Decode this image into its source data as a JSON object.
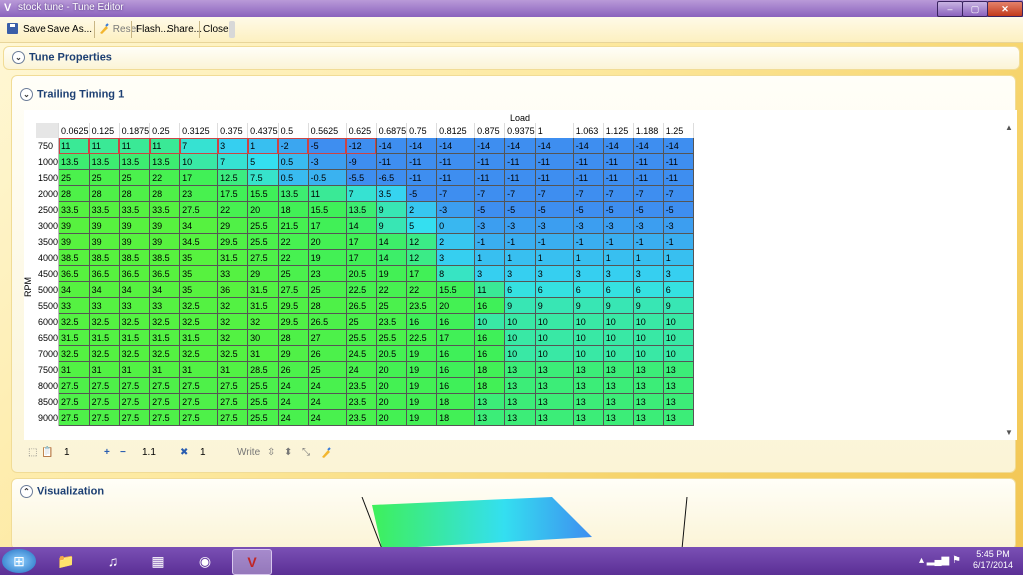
{
  "window": {
    "title": "stock tune - Tune Editor",
    "app_icon": "V",
    "minimize": "‒",
    "maximize": "▢",
    "close": "✕"
  },
  "toolbar": {
    "save": "Save",
    "save_as": "Save As...",
    "reset": "Reset",
    "flash": "Flash...",
    "share": "Share...",
    "close": "Close"
  },
  "panels": {
    "tune_properties": "Tune Properties",
    "trailing_timing": "Trailing Timing 1",
    "visualization": "Visualization"
  },
  "table": {
    "x_axis_label": "Load",
    "y_axis_label": "RPM",
    "columns": [
      "0.0625",
      "0.125",
      "0.1875",
      "0.25",
      "0.3125",
      "0.375",
      "0.4375",
      "0.5",
      "0.5625",
      "0.625",
      "0.6875",
      "0.75",
      "0.8125",
      "0.875",
      "0.9375",
      "1",
      "1.063",
      "1.125",
      "1.188",
      "1.25"
    ],
    "rows": [
      {
        "rpm": "750",
        "values": [
          "11",
          "11",
          "11",
          "11",
          "7",
          "3",
          "1",
          "-2",
          "-5",
          "-12",
          "-14",
          "-14",
          "-14",
          "-14",
          "-14",
          "-14",
          "-14",
          "-14",
          "-14",
          "-14"
        ]
      },
      {
        "rpm": "1000",
        "values": [
          "13.5",
          "13.5",
          "13.5",
          "13.5",
          "10",
          "7",
          "5",
          "0.5",
          "-3",
          "-9",
          "-11",
          "-11",
          "-11",
          "-11",
          "-11",
          "-11",
          "-11",
          "-11",
          "-11",
          "-11"
        ]
      },
      {
        "rpm": "1500",
        "values": [
          "25",
          "25",
          "25",
          "22",
          "17",
          "12.5",
          "7.5",
          "0.5",
          "-0.5",
          "-5.5",
          "-6.5",
          "-11",
          "-11",
          "-11",
          "-11",
          "-11",
          "-11",
          "-11",
          "-11",
          "-11"
        ]
      },
      {
        "rpm": "2000",
        "values": [
          "28",
          "28",
          "28",
          "28",
          "23",
          "17.5",
          "15.5",
          "13.5",
          "11",
          "7",
          "3.5",
          "-5",
          "-7",
          "-7",
          "-7",
          "-7",
          "-7",
          "-7",
          "-7",
          "-7"
        ]
      },
      {
        "rpm": "2500",
        "values": [
          "33.5",
          "33.5",
          "33.5",
          "33.5",
          "27.5",
          "22",
          "20",
          "18",
          "15.5",
          "13.5",
          "9",
          "2",
          "-3",
          "-5",
          "-5",
          "-5",
          "-5",
          "-5",
          "-5",
          "-5"
        ]
      },
      {
        "rpm": "3000",
        "values": [
          "39",
          "39",
          "39",
          "39",
          "34",
          "29",
          "25.5",
          "21.5",
          "17",
          "14",
          "9",
          "5",
          "0",
          "-3",
          "-3",
          "-3",
          "-3",
          "-3",
          "-3",
          "-3"
        ]
      },
      {
        "rpm": "3500",
        "values": [
          "39",
          "39",
          "39",
          "39",
          "34.5",
          "29.5",
          "25.5",
          "22",
          "20",
          "17",
          "14",
          "12",
          "2",
          "-1",
          "-1",
          "-1",
          "-1",
          "-1",
          "-1",
          "-1"
        ]
      },
      {
        "rpm": "4000",
        "values": [
          "38.5",
          "38.5",
          "38.5",
          "38.5",
          "35",
          "31.5",
          "27.5",
          "22",
          "19",
          "17",
          "14",
          "12",
          "3",
          "1",
          "1",
          "1",
          "1",
          "1",
          "1",
          "1"
        ]
      },
      {
        "rpm": "4500",
        "values": [
          "36.5",
          "36.5",
          "36.5",
          "36.5",
          "35",
          "33",
          "29",
          "25",
          "23",
          "20.5",
          "19",
          "17",
          "8",
          "3",
          "3",
          "3",
          "3",
          "3",
          "3",
          "3"
        ]
      },
      {
        "rpm": "5000",
        "values": [
          "34",
          "34",
          "34",
          "34",
          "35",
          "36",
          "31.5",
          "27.5",
          "25",
          "22.5",
          "22",
          "22",
          "15.5",
          "11",
          "6",
          "6",
          "6",
          "6",
          "6",
          "6"
        ]
      },
      {
        "rpm": "5500",
        "values": [
          "33",
          "33",
          "33",
          "33",
          "32.5",
          "32",
          "31.5",
          "29.5",
          "28",
          "26.5",
          "25",
          "23.5",
          "20",
          "16",
          "9",
          "9",
          "9",
          "9",
          "9",
          "9"
        ]
      },
      {
        "rpm": "6000",
        "values": [
          "32.5",
          "32.5",
          "32.5",
          "32.5",
          "32.5",
          "32",
          "32",
          "29.5",
          "26.5",
          "25",
          "23.5",
          "16",
          "16",
          "10",
          "10",
          "10",
          "10",
          "10",
          "10",
          "10"
        ]
      },
      {
        "rpm": "6500",
        "values": [
          "31.5",
          "31.5",
          "31.5",
          "31.5",
          "31.5",
          "32",
          "30",
          "28",
          "27",
          "25.5",
          "25.5",
          "22.5",
          "17",
          "16",
          "10",
          "10",
          "10",
          "10",
          "10",
          "10"
        ]
      },
      {
        "rpm": "7000",
        "values": [
          "32.5",
          "32.5",
          "32.5",
          "32.5",
          "32.5",
          "32.5",
          "31",
          "29",
          "26",
          "24.5",
          "20.5",
          "19",
          "16",
          "16",
          "10",
          "10",
          "10",
          "10",
          "10",
          "10"
        ]
      },
      {
        "rpm": "7500",
        "values": [
          "31",
          "31",
          "31",
          "31",
          "31",
          "31",
          "28.5",
          "26",
          "25",
          "24",
          "20",
          "19",
          "16",
          "18",
          "13",
          "13",
          "13",
          "13",
          "13",
          "13"
        ]
      },
      {
        "rpm": "8000",
        "values": [
          "27.5",
          "27.5",
          "27.5",
          "27.5",
          "27.5",
          "27.5",
          "25.5",
          "24",
          "24",
          "23.5",
          "20",
          "19",
          "16",
          "18",
          "13",
          "13",
          "13",
          "13",
          "13",
          "13"
        ]
      },
      {
        "rpm": "8500",
        "values": [
          "27.5",
          "27.5",
          "27.5",
          "27.5",
          "27.5",
          "27.5",
          "25.5",
          "24",
          "24",
          "23.5",
          "20",
          "19",
          "18",
          "13",
          "13",
          "13",
          "13",
          "13",
          "13",
          "13"
        ]
      },
      {
        "rpm": "9000",
        "values": [
          "27.5",
          "27.5",
          "27.5",
          "27.5",
          "27.5",
          "27.5",
          "25.5",
          "24",
          "24",
          "23.5",
          "20",
          "19",
          "18",
          "13",
          "13",
          "13",
          "13",
          "13",
          "13",
          "13"
        ]
      }
    ]
  },
  "grid_toolbar": {
    "paste_value": "1",
    "plus": "+",
    "minus": "−",
    "scale_value": "1.1",
    "multiply": "✖",
    "mult_value": "1",
    "write": "Write"
  },
  "taskbar": {
    "time": "5:45 PM",
    "date": "6/17/2014"
  },
  "colors": {
    "blue": "#3e8ef0",
    "cyan": "#34dff0",
    "green": "#3ef05a",
    "lime": "#57f23f"
  }
}
